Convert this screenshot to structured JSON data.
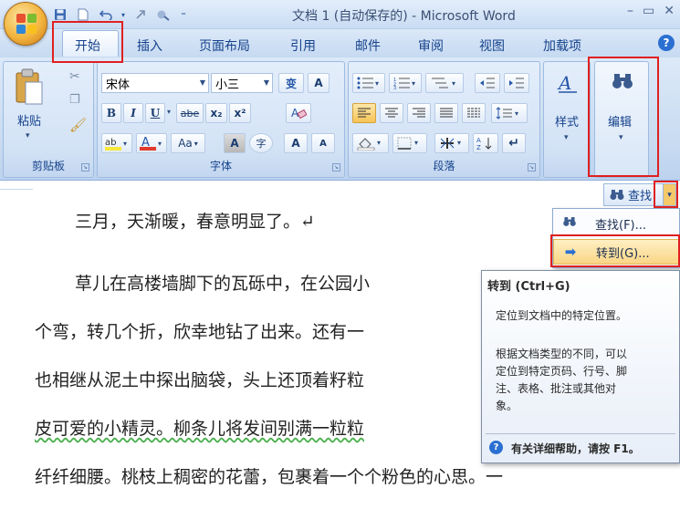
{
  "title_bar": {
    "title": "文档 1 (自动保存的) - Microsoft Word",
    "qat_icons": [
      "save-icon",
      "undo-icon",
      "redo-icon",
      "customize-icon"
    ]
  },
  "tabs": [
    {
      "label": "开始",
      "active": true
    },
    {
      "label": "插入"
    },
    {
      "label": "页面布局"
    },
    {
      "label": "引用"
    },
    {
      "label": "邮件"
    },
    {
      "label": "审阅"
    },
    {
      "label": "视图"
    },
    {
      "label": "加载项"
    }
  ],
  "ribbon": {
    "clipboard": {
      "label": "剪贴板",
      "paste": "粘贴"
    },
    "font": {
      "label": "字体",
      "font_name": "宋体",
      "font_size": "小三",
      "phonetic": "变",
      "border_char": "A",
      "bold": "B",
      "italic": "I",
      "underline": "U",
      "strike": "abe",
      "sub": "x₂",
      "sup": "x²",
      "aa": "Aa",
      "shade_a": "A",
      "enclose": "字",
      "grow": "A",
      "shrink": "A"
    },
    "paragraph": {
      "label": "段落"
    },
    "styles": {
      "label": "样式"
    },
    "editing": {
      "label": "编辑"
    }
  },
  "find_menu": {
    "split_label": "查找",
    "items": [
      {
        "label": "查找(F)..."
      },
      {
        "label": "转到(G)..."
      }
    ]
  },
  "tooltip": {
    "title": "转到 (Ctrl+G)",
    "line1": "定位到文档中的特定位置。",
    "para2": [
      "根据文档类型的不同，可以",
      "定位到特定页码、行号、脚",
      "注、表格、批注或其他对",
      "象。"
    ],
    "help": "有关详细帮助，请按 F1。"
  },
  "document": {
    "lines": [
      "三月，天渐暖，春意明显了。↵",
      "草儿在高楼墙脚下的瓦砾中，在公园小",
      "个弯，转几个折，欣幸地钻了出来。还有一",
      "也相继从泥土中探出脑袋，头上还顶着籽粒",
      "皮可爱的小精灵。柳条儿将发间别满一粒粒",
      "纤纤细腰。桃枝上稠密的花蕾，包裹着一个个粉色的心思。一"
    ]
  },
  "colors": {
    "highlight": "#f7e93b",
    "font_color": "#e23a2b",
    "annotation_red": "#e02020"
  }
}
